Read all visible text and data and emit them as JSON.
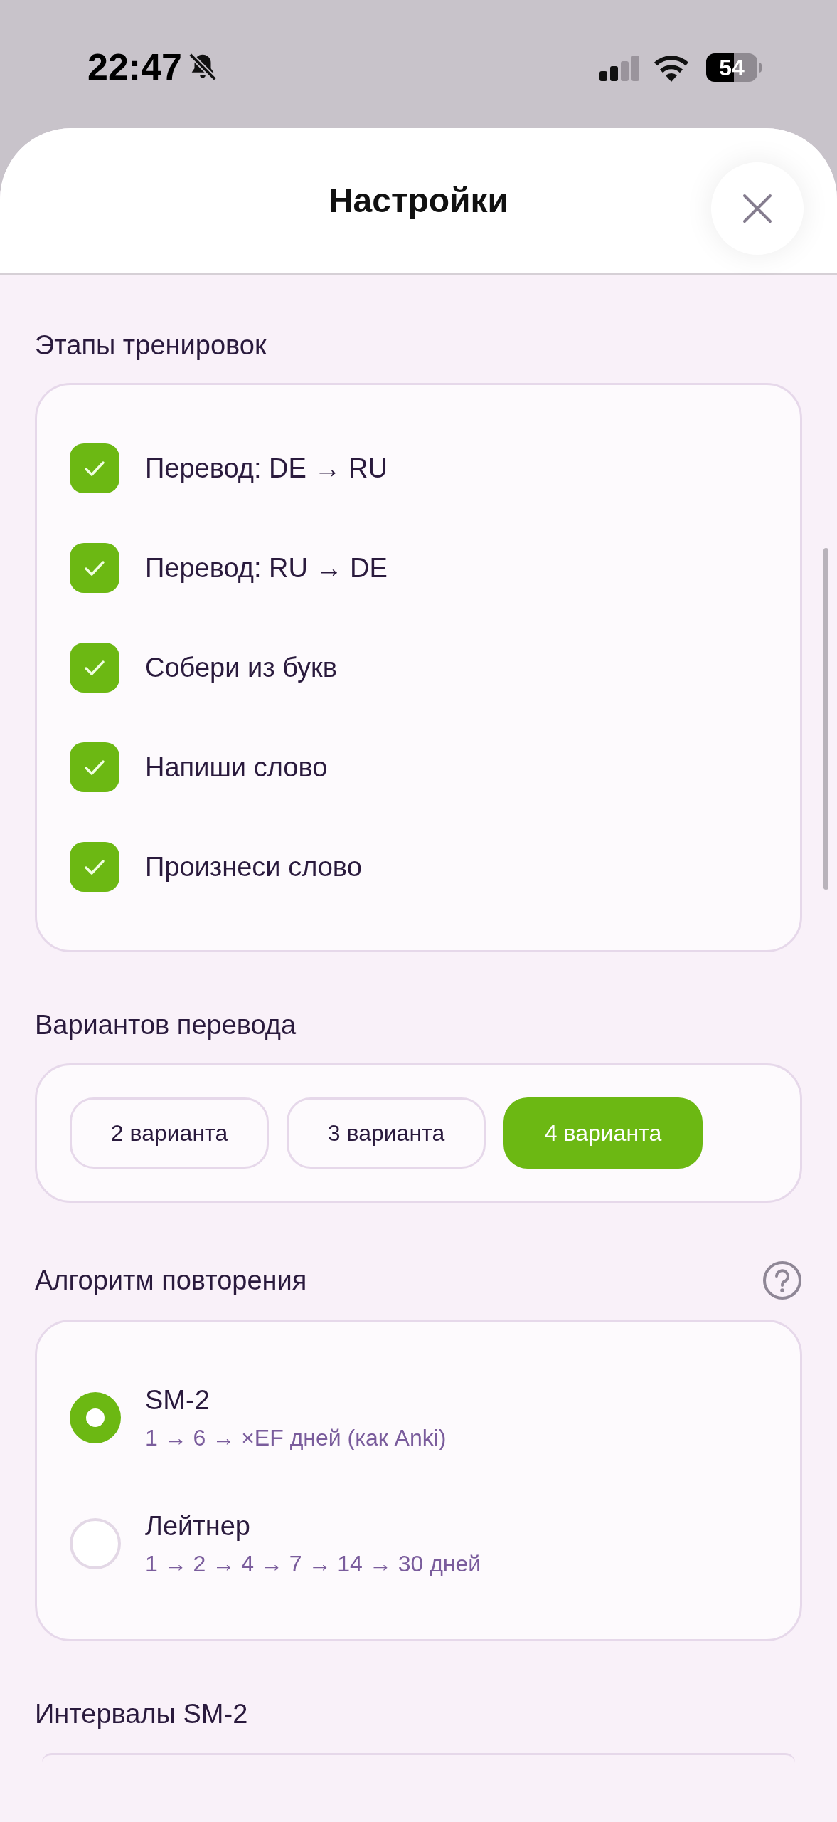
{
  "status_bar": {
    "time": "22:47",
    "battery": "54"
  },
  "header": {
    "title": "Настройки"
  },
  "training_stages": {
    "label": "Этапы тренировок",
    "items": [
      {
        "label": "Перевод: DE → RU",
        "checked": true
      },
      {
        "label": "Перевод: RU → DE",
        "checked": true
      },
      {
        "label": "Собери из букв",
        "checked": true
      },
      {
        "label": "Напиши слово",
        "checked": true
      },
      {
        "label": "Произнеси слово",
        "checked": true
      }
    ]
  },
  "translation_options": {
    "label": "Вариантов перевода",
    "options": [
      {
        "label": "2 варианта",
        "selected": false
      },
      {
        "label": "3 варианта",
        "selected": false
      },
      {
        "label": "4 варианта",
        "selected": true
      }
    ]
  },
  "algorithm": {
    "label": "Алгоритм повторения",
    "options": [
      {
        "title": "SM-2",
        "description": "1 → 6 → ×EF дней (как Anki)",
        "selected": true
      },
      {
        "title": "Лейтнер",
        "description": "1 → 2 → 4 → 7 → 14 → 30 дней",
        "selected": false
      }
    ]
  },
  "intervals": {
    "label": "Интервалы SM-2"
  }
}
